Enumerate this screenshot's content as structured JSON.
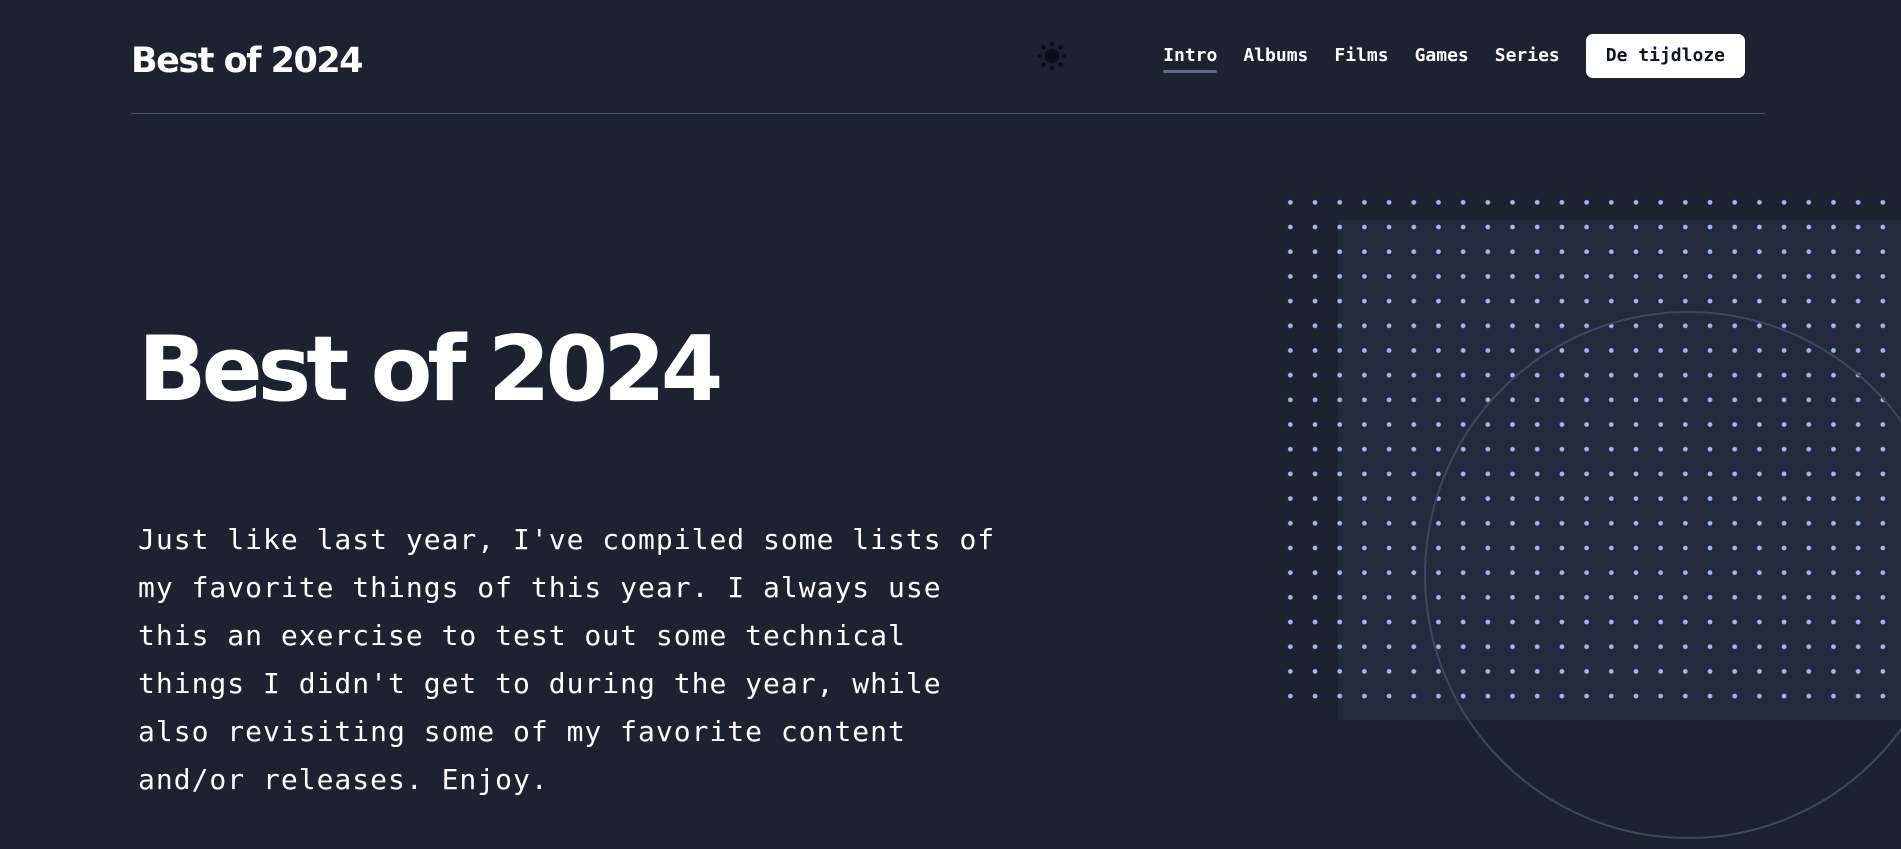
{
  "header": {
    "site_title": "Best of 2024",
    "theme_toggle_icon": "sun-icon",
    "nav": {
      "items": [
        {
          "label": "Intro",
          "active": true
        },
        {
          "label": "Albums",
          "active": false
        },
        {
          "label": "Films",
          "active": false
        },
        {
          "label": "Games",
          "active": false
        },
        {
          "label": "Series",
          "active": false
        }
      ],
      "cta_label": "De tijdloze"
    }
  },
  "hero": {
    "title": "Best of 2024",
    "intro": "Just like last year, I've compiled some lists of my favorite things of this year. I always use this an exercise to test out some technical things I didn't get to during the year, while also revisiting some of my favorite content and/or releases. Enjoy."
  },
  "colors": {
    "background": "#1d2231",
    "text": "#ffffff",
    "accent_dots": "#a3b7ef",
    "nav_underline": "#5d6a90",
    "cta_background": "#ffffff",
    "cta_text": "#111522"
  }
}
